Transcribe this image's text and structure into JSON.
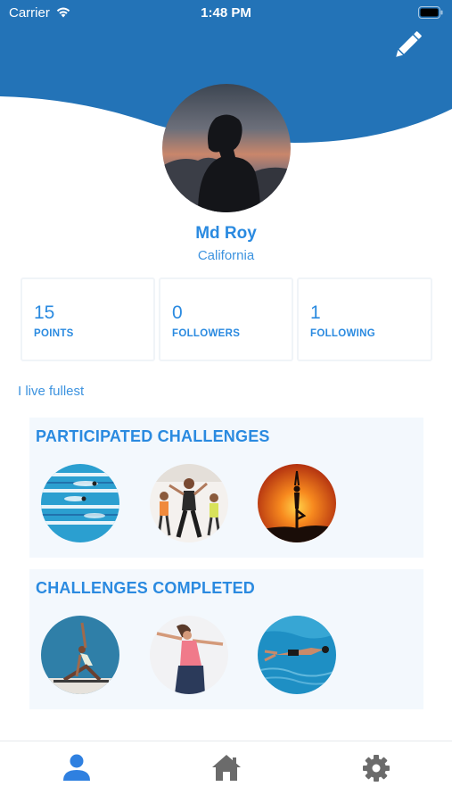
{
  "status_bar": {
    "carrier": "Carrier",
    "time": "1:48 PM"
  },
  "colors": {
    "header_blue": "#2373b7",
    "accent_blue": "#2a8ae0",
    "section_bg": "#f3f8fd",
    "tab_active": "#2f80e0",
    "tab_inactive": "#6b6b6b"
  },
  "header": {
    "edit_icon": "pencil-icon"
  },
  "profile": {
    "name": "Md Roy",
    "location": "California",
    "bio": "I live fullest"
  },
  "stats": [
    {
      "value": "15",
      "label": "POINTS"
    },
    {
      "value": "0",
      "label": "FOLLOWERS"
    },
    {
      "value": "1",
      "label": "FOLLOWING"
    }
  ],
  "sections": {
    "participated": {
      "title": "PARTICIPATED CHALLENGES",
      "items": [
        "swimming-lanes-photo",
        "dance-class-photo",
        "yoga-sunset-photo"
      ]
    },
    "completed": {
      "title": "CHALLENGES COMPLETED",
      "items": [
        "yoga-stretch-photo",
        "dancer-photo",
        "underwater-swimmer-photo"
      ]
    }
  },
  "tab_bar": {
    "tabs": [
      {
        "icon": "person-icon",
        "active": true
      },
      {
        "icon": "home-icon",
        "active": false
      },
      {
        "icon": "gear-icon",
        "active": false
      }
    ]
  }
}
